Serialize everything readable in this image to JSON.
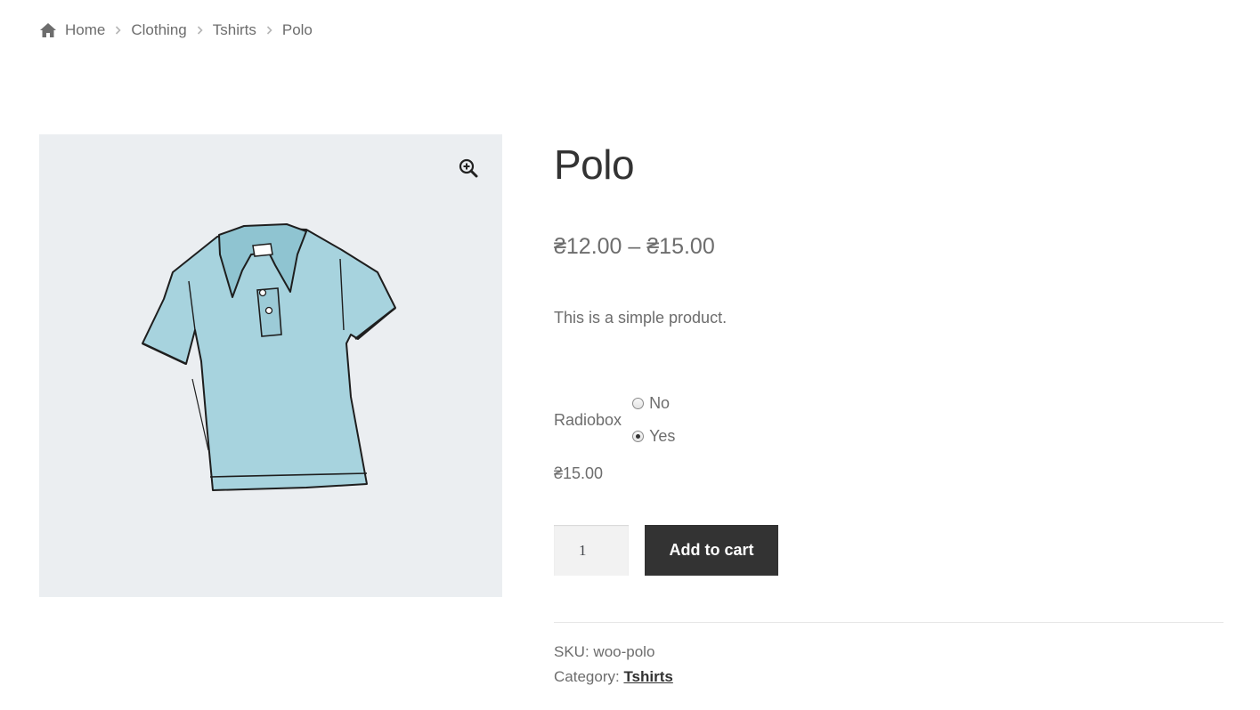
{
  "breadcrumb": {
    "items": [
      "Home",
      "Clothing",
      "Tshirts"
    ],
    "current": "Polo"
  },
  "gallery": {
    "zoom_icon": "zoom-in-icon",
    "image_subject": "light blue polo shirt illustration",
    "image_color": "#a7d3de"
  },
  "product": {
    "title": "Polo",
    "price_range": "₴12.00 – ₴15.00",
    "short_description": "This is a simple product.",
    "variation": {
      "label": "Radiobox",
      "options": [
        {
          "label": "No",
          "checked": false
        },
        {
          "label": "Yes",
          "checked": true
        }
      ]
    },
    "variation_price": "₴15.00",
    "quantity": "1",
    "add_to_cart_label": "Add to cart",
    "meta": {
      "sku_label": "SKU:",
      "sku_value": "woo-polo",
      "category_label": "Category:",
      "category_value": "Tshirts"
    }
  },
  "colors": {
    "button_bg": "#333333",
    "gallery_bg": "#ebeef1",
    "text": "#6d6d6d"
  }
}
